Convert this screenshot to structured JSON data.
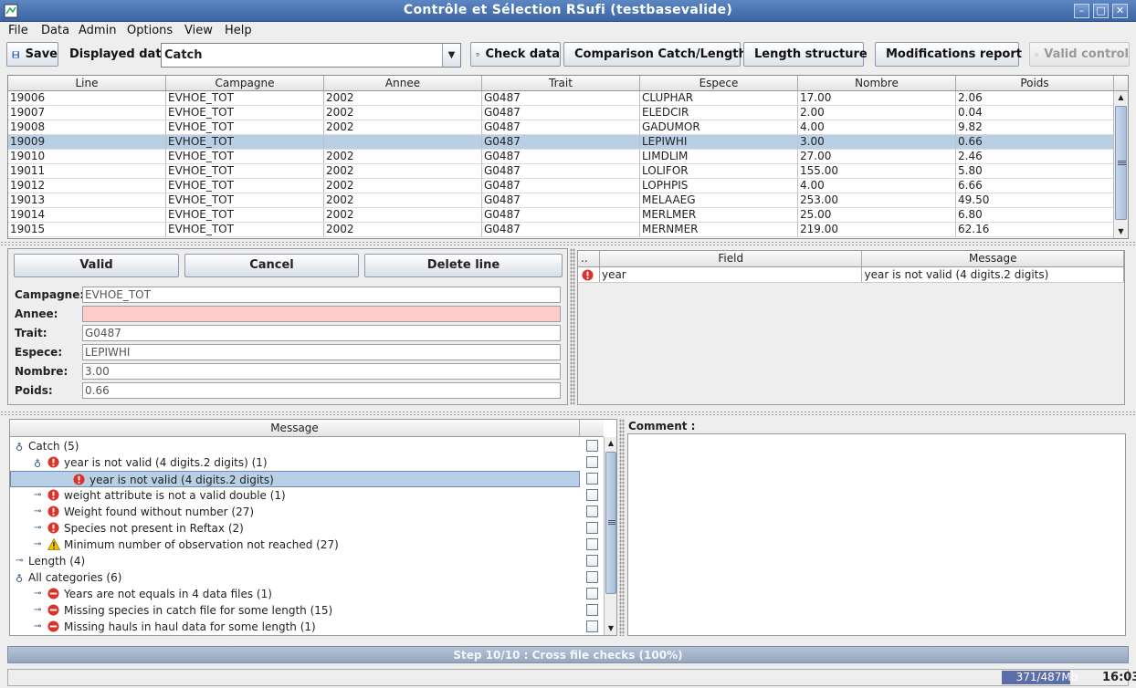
{
  "window": {
    "title": "Contrôle et Sélection RSufi (testbasevalide)"
  },
  "menu": [
    "File",
    "Data",
    "Admin",
    "Options",
    "View",
    "Help"
  ],
  "toolbar": {
    "save": "Save",
    "displayed_label": "Displayed data :",
    "displayed_value": "Catch",
    "check_data": "Check data",
    "comparison": "Comparison Catch/Length",
    "length_structure": "Length structure",
    "modifications_report": "Modifications report",
    "valid_control": "Valid control"
  },
  "table": {
    "columns": [
      "Line",
      "Campagne",
      "Annee",
      "Trait",
      "Espece",
      "Nombre",
      "Poids"
    ],
    "rows": [
      [
        "19006",
        "EVHOE_TOT",
        "2002",
        "G0487",
        "CLUPHAR",
        "17.00",
        "2.06"
      ],
      [
        "19007",
        "EVHOE_TOT",
        "2002",
        "G0487",
        "ELEDCIR",
        "2.00",
        "0.04"
      ],
      [
        "19008",
        "EVHOE_TOT",
        "2002",
        "G0487",
        "GADUMOR",
        "4.00",
        "9.82"
      ],
      [
        "19009",
        "EVHOE_TOT",
        "",
        "G0487",
        "LEPIWHI",
        "3.00",
        "0.66"
      ],
      [
        "19010",
        "EVHOE_TOT",
        "2002",
        "G0487",
        "LIMDLIM",
        "27.00",
        "2.46"
      ],
      [
        "19011",
        "EVHOE_TOT",
        "2002",
        "G0487",
        "LOLIFOR",
        "155.00",
        "5.80"
      ],
      [
        "19012",
        "EVHOE_TOT",
        "2002",
        "G0487",
        "LOPHPIS",
        "4.00",
        "6.66"
      ],
      [
        "19013",
        "EVHOE_TOT",
        "2002",
        "G0487",
        "MELAAEG",
        "253.00",
        "49.50"
      ],
      [
        "19014",
        "EVHOE_TOT",
        "2002",
        "G0487",
        "MERLMER",
        "25.00",
        "6.80"
      ],
      [
        "19015",
        "EVHOE_TOT",
        "2002",
        "G0487",
        "MERNMER",
        "219.00",
        "62.16"
      ]
    ],
    "selected_row": 3
  },
  "form": {
    "valid": "Valid",
    "cancel": "Cancel",
    "delete_line": "Delete line",
    "fields": [
      {
        "label": "Campagne:",
        "value": "EVHOE_TOT"
      },
      {
        "label": "Annee:",
        "value": ""
      },
      {
        "label": "Trait:",
        "value": "G0487"
      },
      {
        "label": "Espece:",
        "value": "LEPIWHI"
      },
      {
        "label": "Nombre:",
        "value": "3.00"
      },
      {
        "label": "Poids:",
        "value": "0.66"
      }
    ]
  },
  "errors": {
    "columns": [
      "..",
      "Field",
      "Message"
    ],
    "rows": [
      {
        "field": "year",
        "message": "year is not valid (4 digits.2 digits)"
      }
    ]
  },
  "messages": {
    "header": "Message",
    "items": [
      {
        "text": "Catch (5)",
        "level": 0,
        "icon": "none",
        "expanded": true
      },
      {
        "text": "year is not valid (4 digits.2 digits) (1)",
        "level": 1,
        "icon": "error",
        "expanded": true
      },
      {
        "text": "year is not valid (4 digits.2 digits)",
        "level": 2,
        "icon": "error",
        "selected": true
      },
      {
        "text": "weight attribute is not a valid double (1)",
        "level": 1,
        "icon": "error"
      },
      {
        "text": "Weight found without number (27)",
        "level": 1,
        "icon": "error"
      },
      {
        "text": "Species not present in Reftax (2)",
        "level": 1,
        "icon": "error"
      },
      {
        "text": "Minimum number of observation not reached (27)",
        "level": 1,
        "icon": "warning"
      },
      {
        "text": "Length (4)",
        "level": 0,
        "icon": "none"
      },
      {
        "text": "All categories (6)",
        "level": 0,
        "icon": "none",
        "expanded": true
      },
      {
        "text": "Years are not equals in 4 data files (1)",
        "level": 1,
        "icon": "stop"
      },
      {
        "text": "Missing species in catch file for some length (15)",
        "level": 1,
        "icon": "stop"
      },
      {
        "text": "Missing hauls in haul data for some length (1)",
        "level": 1,
        "icon": "stop"
      }
    ]
  },
  "comment": {
    "label": "Comment :"
  },
  "progress": {
    "text": "Step 10/10 : Cross file checks (100%)",
    "value": 1.0
  },
  "status": {
    "memory": "371/487Mb",
    "memory_fraction": 0.76,
    "clock": "16:03"
  },
  "colors": {
    "selection": "#b8cfe5",
    "error_field": "#ffcccc",
    "titlebar": "#4a72b0"
  }
}
